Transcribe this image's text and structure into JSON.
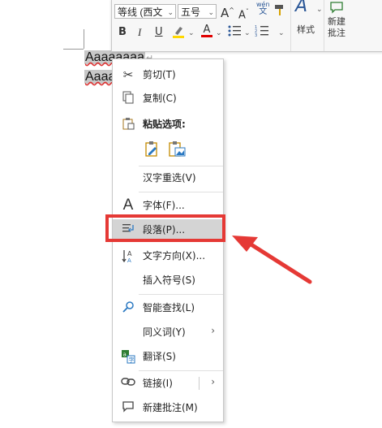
{
  "document": {
    "lines": [
      "Aaaaaaaa",
      "Aaaa"
    ]
  },
  "mini_toolbar": {
    "font_name": "等线 (西文",
    "font_size": "五号",
    "style_label": "样式",
    "new_comment_line1": "新建",
    "new_comment_line2": "批注",
    "buttons": {
      "bold": "B",
      "italic": "I",
      "underline": "U",
      "grow_font": "A",
      "shrink_font": "A",
      "font_color": "A",
      "wen": "wén",
      "wen_sub": "文"
    }
  },
  "context_menu": {
    "items": [
      {
        "label": "剪切(T)"
      },
      {
        "label": "复制(C)"
      },
      {
        "label": "粘贴选项:"
      },
      {
        "label": "汉字重选(V)"
      },
      {
        "label": "字体(F)..."
      },
      {
        "label": "段落(P)..."
      },
      {
        "label": "文字方向(X)..."
      },
      {
        "label": "插入符号(S)"
      },
      {
        "label": "智能查找(L)"
      },
      {
        "label": "同义词(Y)"
      },
      {
        "label": "翻译(S)"
      },
      {
        "label": "链接(I)"
      },
      {
        "label": "新建批注(M)"
      }
    ],
    "highlighted_item": "段落(P)..."
  },
  "colors": {
    "highlight_color": "#ffd800",
    "font_color": "#e00000",
    "annotation_red": "#e53935"
  }
}
